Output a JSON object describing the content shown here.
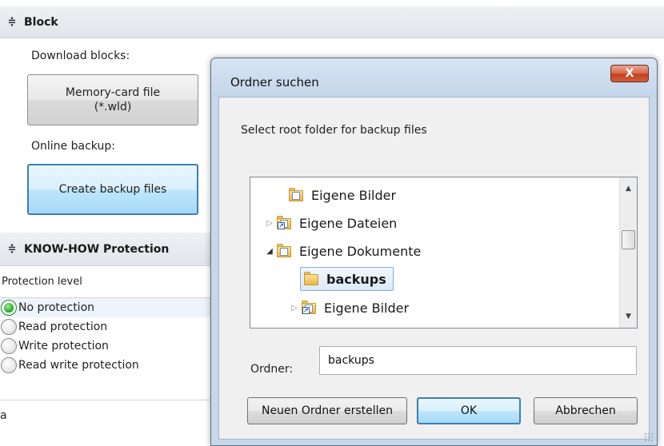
{
  "block_section": {
    "title": "Block",
    "download_label": "Download blocks:",
    "memory_card_button_line1": "Memory-card file",
    "memory_card_button_line2": "(*.wld)",
    "online_backup_label": "Online backup:",
    "create_backup_button": "Create backup files"
  },
  "knowhow_section": {
    "title": "KNOW-HOW Protection",
    "column_header": "Protection level",
    "options": [
      {
        "label": "No protection",
        "selected": true
      },
      {
        "label": "Read protection",
        "selected": false
      },
      {
        "label": "Write protection",
        "selected": false
      },
      {
        "label": "Read write protection",
        "selected": false
      }
    ],
    "stray_text": "a"
  },
  "dialog": {
    "title": "Ordner suchen",
    "close_label": "X",
    "instruction": "Select root folder for backup files",
    "tree": [
      {
        "label": "Eigene Bilder",
        "expander": "",
        "icon": "pictures-folder-icon"
      },
      {
        "label": "Eigene Dateien",
        "expander": "collapsed",
        "icon": "shortcut-folder-icon"
      },
      {
        "label": "Eigene Dokumente",
        "expander": "expanded",
        "icon": "documents-folder-icon"
      },
      {
        "label": "backups",
        "expander": "",
        "icon": "folder-icon",
        "selected": true
      },
      {
        "label": "Eigene Bilder",
        "expander": "collapsed",
        "icon": "shortcut-folder-icon"
      }
    ],
    "folder_label": "Ordner:",
    "folder_value": "backups",
    "new_folder_button": "Neuen Ordner erstellen",
    "ok_button": "OK",
    "cancel_button": "Abbrechen"
  },
  "colors": {
    "accent_border": "#3c7fb1",
    "selected_radio": "#20a020",
    "close_button": "#c3401f"
  }
}
